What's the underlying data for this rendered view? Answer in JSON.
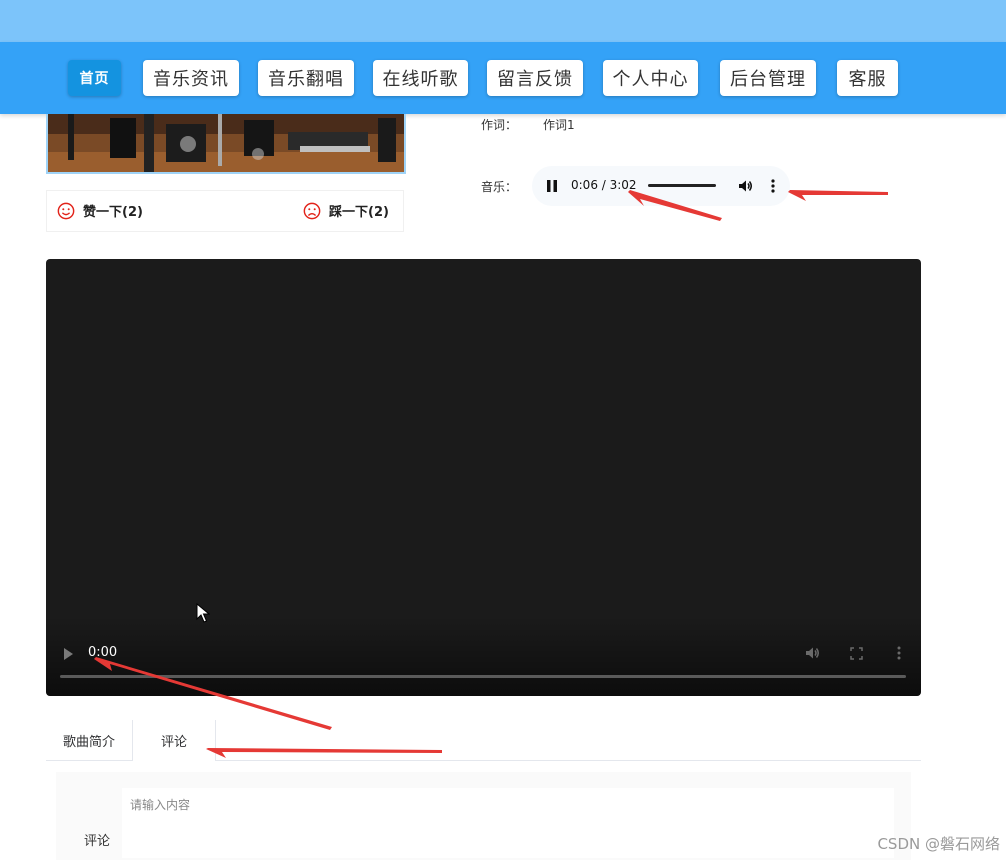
{
  "nav": {
    "items": [
      {
        "label": "首页",
        "active": true
      },
      {
        "label": "音乐资讯",
        "active": false
      },
      {
        "label": "音乐翻唱",
        "active": false
      },
      {
        "label": "在线听歌",
        "active": false
      },
      {
        "label": "留言反馈",
        "active": false
      },
      {
        "label": "个人中心",
        "active": false
      },
      {
        "label": "后台管理",
        "active": false
      },
      {
        "label": "客服",
        "active": false
      }
    ]
  },
  "song": {
    "lyrics_label": "作词：",
    "lyrics_value": "作词1",
    "music_label": "音乐："
  },
  "audio": {
    "time": "0:06 / 3:02",
    "playing": true,
    "progress": 0.033
  },
  "votes": {
    "like": "赞一下(2)",
    "dislike": "踩一下(2)"
  },
  "video": {
    "time": "0:00",
    "progress": 0
  },
  "tabs": {
    "items": [
      {
        "label": "歌曲简介",
        "active": false
      },
      {
        "label": "评论",
        "active": true
      }
    ]
  },
  "comment": {
    "label": "评论",
    "placeholder": "请输入内容"
  },
  "watermark": "CSDN @磐石网络",
  "colors": {
    "nav_bg": "#34a2f7",
    "top_band": "#7cc4fa",
    "active_nav": "#1493e0",
    "annotation_arrow": "#e53935",
    "vote_icon": "#e2231a"
  }
}
